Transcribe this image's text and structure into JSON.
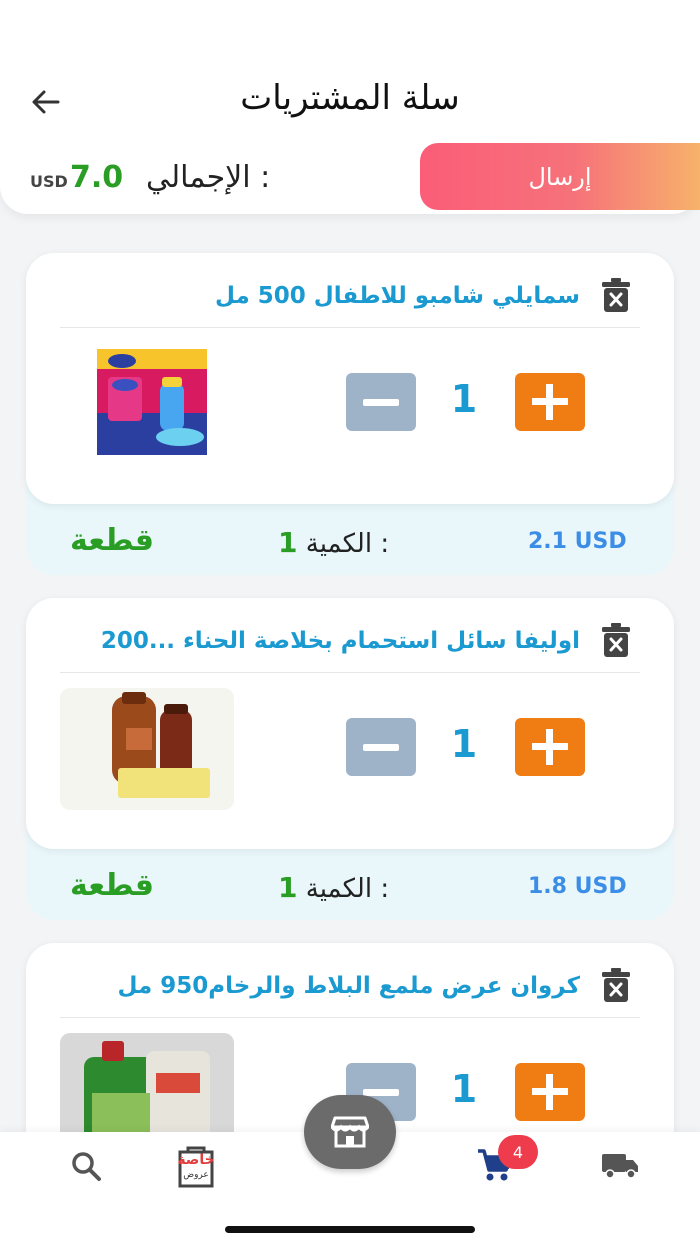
{
  "header": {
    "title": "سلة المشتريات",
    "send_label": "إرسال",
    "total_label": "الإجمالي :",
    "total_value": "7.0",
    "currency": "USD"
  },
  "items": [
    {
      "name": "سمايلي شامبو للاطفال 500 مل",
      "quantity": "1",
      "qty_label": "الكمية :",
      "qty_value": "1",
      "unit": "قطعة",
      "price": "2.1 USD"
    },
    {
      "name": "اوليفا سائل استحمام بخلاصة الحناء ...200",
      "quantity": "1",
      "qty_label": "الكمية :",
      "qty_value": "1",
      "unit": "قطعة",
      "price": "1.8 USD"
    },
    {
      "name": "كروان عرض ملمع البلاط والرخام950 مل",
      "quantity": "1"
    }
  ],
  "nav": {
    "cart_count": "4",
    "logo_text": "خاصة",
    "logo_sub": "عروض",
    "icons": [
      "search-icon",
      "offers-logo",
      "store-icon",
      "cart-icon",
      "truck-icon"
    ]
  },
  "colors": {
    "accent_blue": "#1a9ad1",
    "green": "#2a9d24",
    "orange": "#f07d14",
    "minus_gray": "#9eb2c8",
    "badge_red": "#ee3c4c"
  }
}
